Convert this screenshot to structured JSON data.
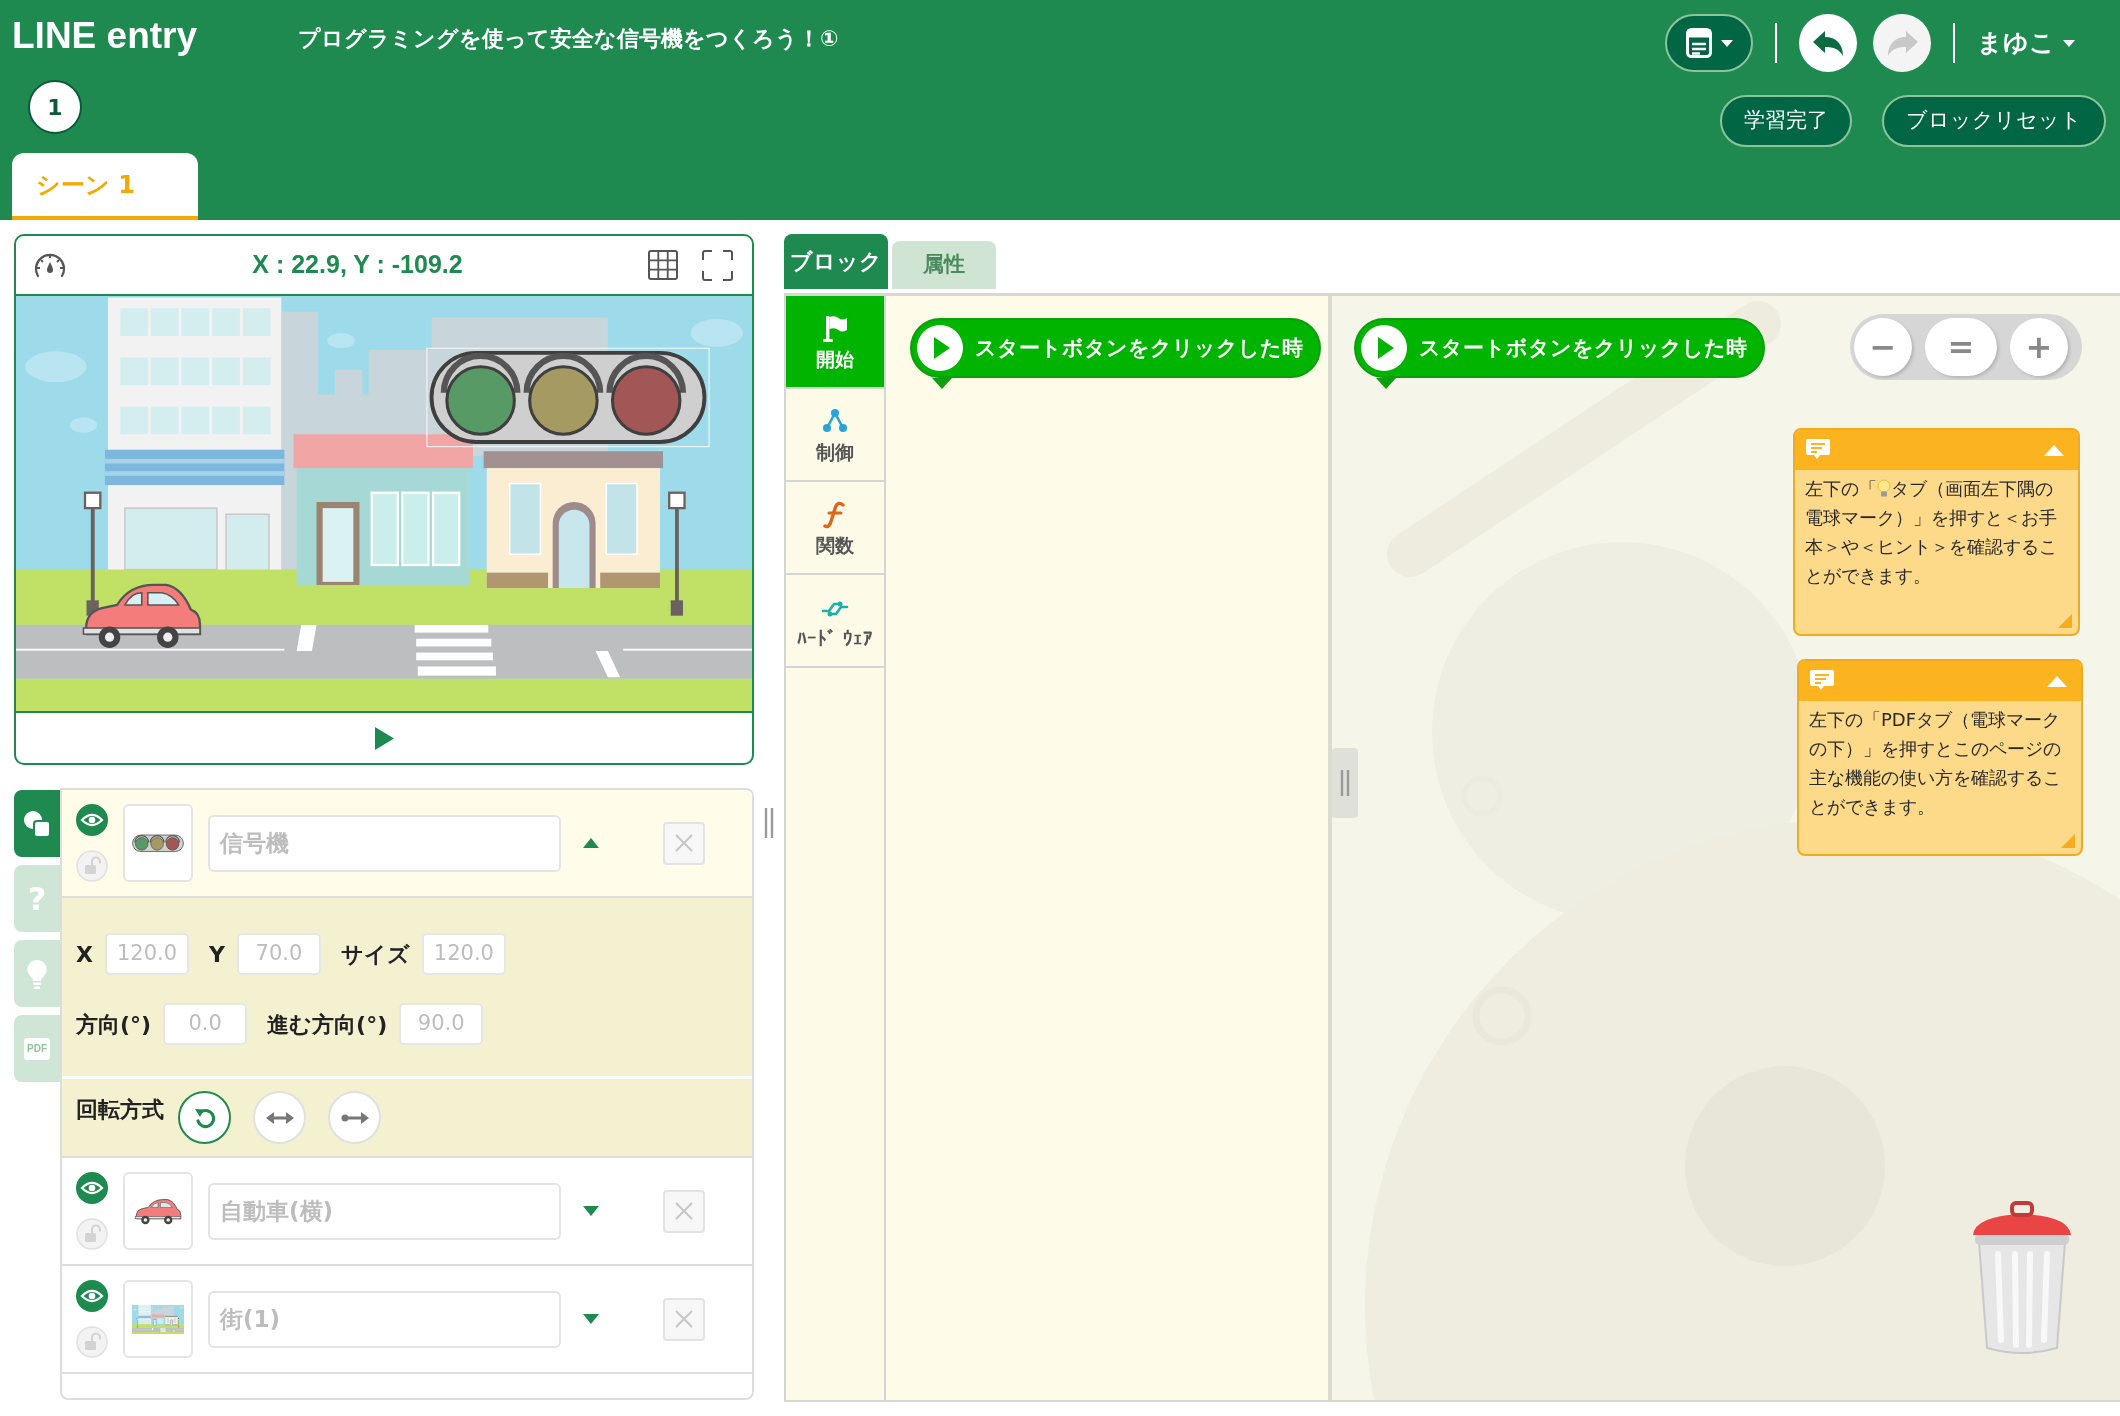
{
  "header": {
    "logo": "LINE entry",
    "title": "プログラミングを使って安全な信号機をつくろう！①",
    "step": "1",
    "scene_tabs": [
      {
        "label": "シーン 1",
        "selected": true
      }
    ],
    "history": [
      {
        "kind": "undo",
        "disabled": false
      },
      {
        "kind": "redo",
        "disabled": true
      }
    ],
    "user": "まゆこ",
    "actions": [
      "学習完了",
      "ブロックリセット"
    ]
  },
  "stage": {
    "coordinates": "X : 22.9, Y : -109.2"
  },
  "side_tabs": [
    {
      "kind": "objects",
      "selected": true
    },
    {
      "kind": "help",
      "label": "?",
      "selected": false
    },
    {
      "kind": "hint",
      "selected": false
    },
    {
      "kind": "pdf",
      "label": "PDF",
      "selected": false
    }
  ],
  "objects": [
    {
      "kind": "traffic_light",
      "name": "信号機",
      "selected": true,
      "expanded": true,
      "visible": true,
      "locked": false,
      "properties": {
        "rows": [
          [
            {
              "label": "X",
              "value": "120.0"
            },
            {
              "label": "Y",
              "value": "70.0"
            },
            {
              "label": "サイズ",
              "value": "120.0"
            }
          ],
          [
            {
              "label": "方向(°)",
              "value": "0.0"
            },
            {
              "label": "進む方向(°)",
              "value": "90.0"
            }
          ]
        ],
        "rotation": {
          "label": "回転方式",
          "options": [
            {
              "kind": "free",
              "selected": true
            },
            {
              "kind": "horizontal",
              "selected": false
            },
            {
              "kind": "none",
              "selected": false
            }
          ]
        }
      }
    },
    {
      "kind": "car",
      "name": "自動車(横)",
      "selected": false,
      "expanded": false,
      "visible": true,
      "locked": false
    },
    {
      "kind": "background",
      "name": "街(1)",
      "selected": false,
      "expanded": false,
      "visible": true,
      "locked": false
    }
  ],
  "panel_tabs": [
    {
      "label": "ブロック",
      "selected": true
    },
    {
      "label": "属性",
      "selected": false
    }
  ],
  "categories": [
    {
      "kind": "start",
      "label": "開始",
      "selected": true
    },
    {
      "kind": "control",
      "label": "制御",
      "selected": false
    },
    {
      "kind": "function",
      "label": "関数",
      "selected": false
    },
    {
      "kind": "hardware",
      "label": "ﾊｰﾄﾞ ｳｪｱ",
      "selected": false
    }
  ],
  "palette": {
    "blocks": [
      {
        "text": "スタートボタンをクリックした時"
      }
    ]
  },
  "workspace": {
    "blocks": [
      {
        "text": "スタートボタンをクリックした時"
      }
    ],
    "zoom_controls": [
      "−",
      "=",
      "+"
    ],
    "comments": [
      {
        "icon_line": [
          "左下の「",
          "タブ（画面左下隅の"
        ],
        "text": "電球マーク）」を押すと＜お手本＞や＜ヒント＞を確認することができます。"
      },
      {
        "text": "左下の「PDFタブ（電球マークの下）」を押すとこのページの主な機能の使い方を確認することができます。"
      }
    ]
  }
}
